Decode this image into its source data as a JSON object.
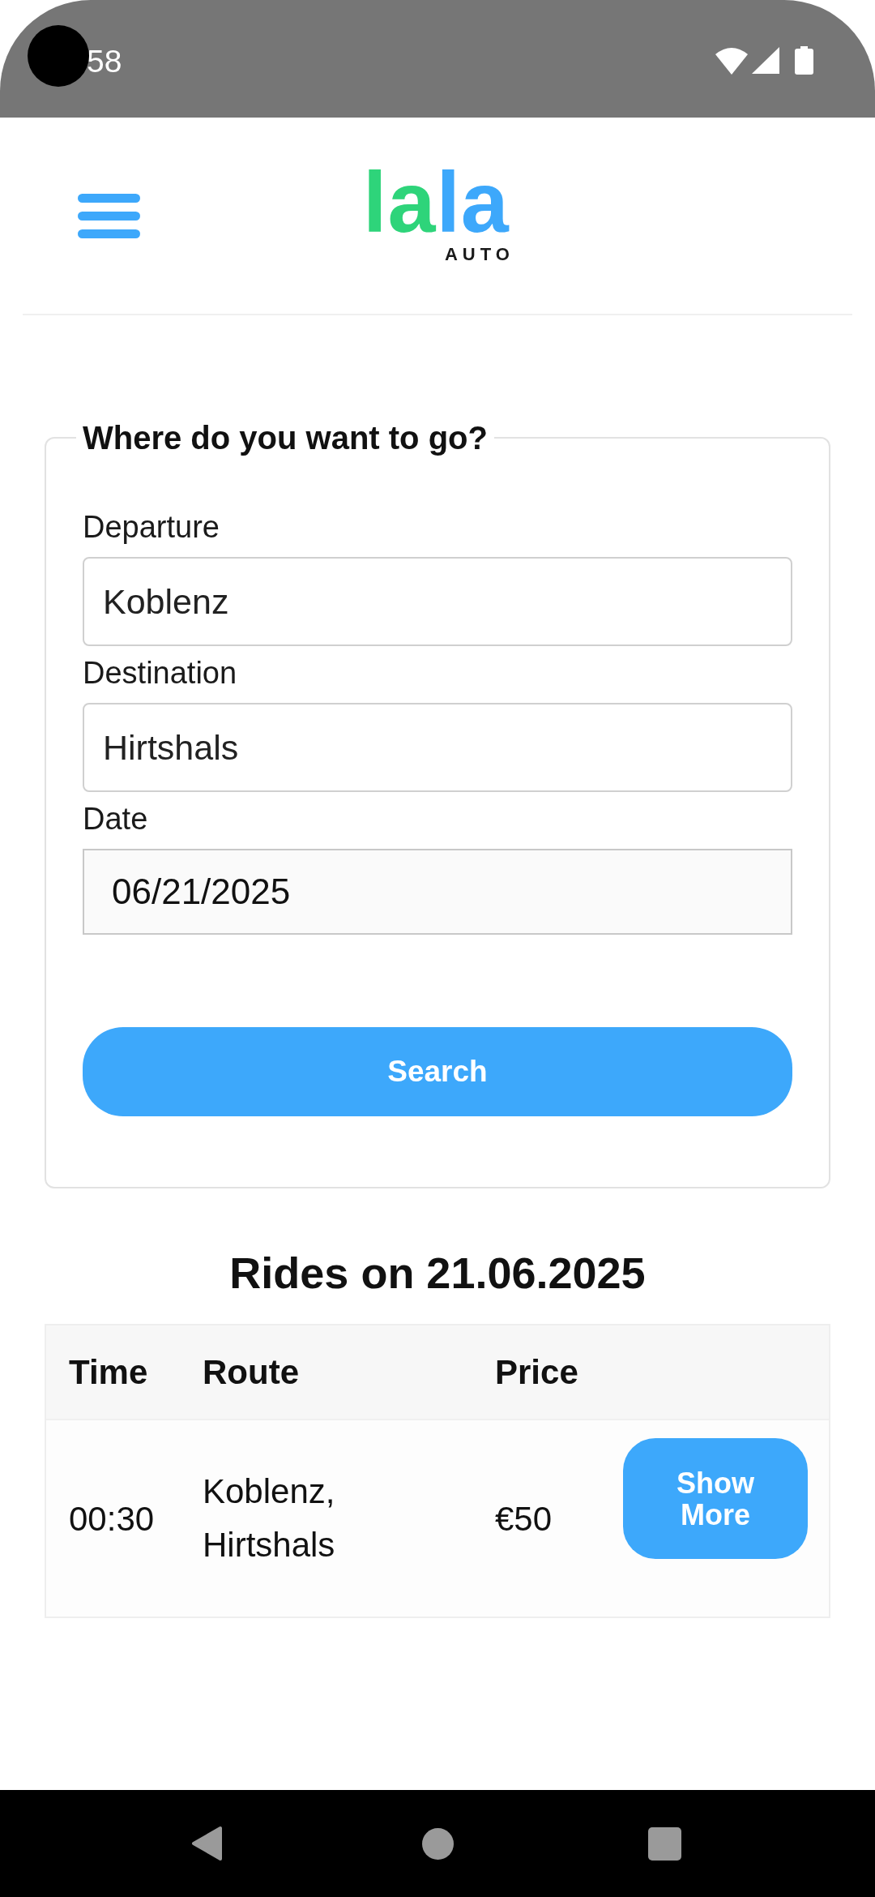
{
  "status_bar": {
    "time": "58"
  },
  "header": {
    "logo": {
      "parts": [
        {
          "text": "la",
          "color": "#2ed47a"
        },
        {
          "text": "la",
          "color": "#3da8fb"
        }
      ],
      "tagline": "AUTO"
    }
  },
  "search_form": {
    "title": "Where do you want to go?",
    "fields": [
      {
        "label": "Departure",
        "value": "Koblenz",
        "kind": "text"
      },
      {
        "label": "Destination",
        "value": "Hirtshals",
        "kind": "text"
      },
      {
        "label": "Date",
        "value": "06/21/2025",
        "kind": "date"
      }
    ],
    "button": "Search"
  },
  "results": {
    "title": "Rides on 21.06.2025",
    "columns": [
      "Time",
      "Route",
      "Price"
    ],
    "rows": [
      {
        "time": "00:30",
        "route": "Koblenz, Hirtshals",
        "price": "€50",
        "action": "Show More"
      }
    ]
  }
}
